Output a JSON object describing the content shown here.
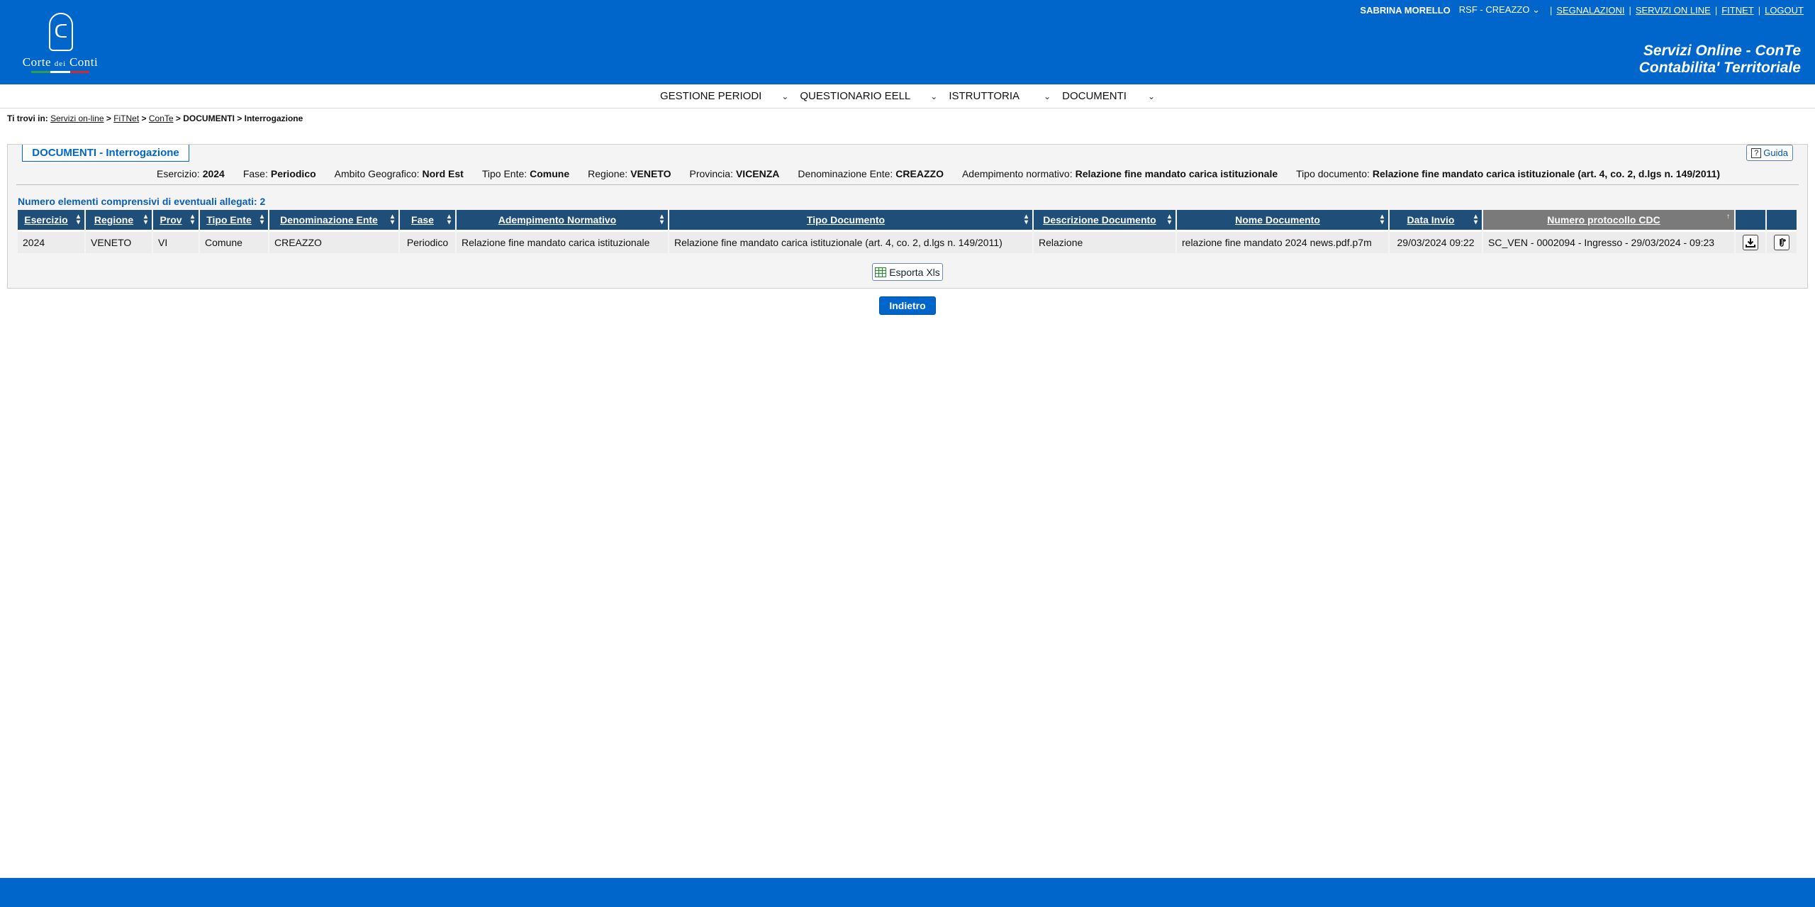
{
  "header": {
    "logo_text_main": "Corte",
    "logo_text_small": "dei",
    "logo_text_end": "Conti",
    "user_name": "SABRINA MORELLO",
    "ente": "RSF  - CREAZZO",
    "links": [
      "SEGNALAZIONI",
      "SERVIZI ON LINE",
      "FITNET",
      "LOGOUT"
    ],
    "service_line1": "Servizi Online - ConTe",
    "service_line2": "Contabilita' Territoriale"
  },
  "menu": {
    "items": [
      "GESTIONE PERIODI",
      "QUESTIONARIO EELL",
      "ISTRUTTORIA",
      "DOCUMENTI"
    ]
  },
  "breadcrumb": {
    "prefix": "Ti trovi in:",
    "links": [
      "Servizi on-line",
      "FiTNet",
      "ConTe"
    ],
    "current1": "DOCUMENTI",
    "current2": "Interrogazione"
  },
  "panel": {
    "tab_title": "DOCUMENTI - Interrogazione",
    "guide_label": "Guida",
    "filters": [
      {
        "label": "Esercizio:",
        "value": "2024"
      },
      {
        "label": "Fase:",
        "value": "Periodico"
      },
      {
        "label": "Ambito Geografico:",
        "value": "Nord Est"
      },
      {
        "label": "Tipo Ente:",
        "value": "Comune"
      },
      {
        "label": "Regione:",
        "value": "VENETO"
      },
      {
        "label": "Provincia:",
        "value": "VICENZA"
      },
      {
        "label": "Denominazione Ente:",
        "value": "CREAZZO"
      },
      {
        "label": "Adempimento normativo:",
        "value": "Relazione fine mandato carica istituzionale"
      },
      {
        "label": "Tipo documento:",
        "value": "Relazione fine mandato carica istituzionale (art. 4, co. 2, d.lgs n. 149/2011)"
      }
    ],
    "count_label": "Numero elementi comprensivi di eventuali allegati: 2"
  },
  "table": {
    "headers": [
      "Esercizio",
      "Regione",
      "Prov",
      "Tipo Ente",
      "Denominazione Ente",
      "Fase",
      "Adempimento Normativo",
      "Tipo Documento",
      "Descrizione Documento",
      "Nome Documento",
      "Data Invio",
      "Numero protocollo CDC"
    ],
    "rows": [
      [
        "2024",
        "VENETO",
        "VI",
        "Comune",
        "CREAZZO",
        "Periodico",
        "Relazione fine mandato carica istituzionale",
        "Relazione fine mandato carica istituzionale (art. 4, co. 2, d.lgs n. 149/2011)",
        "Relazione",
        "relazione fine mandato 2024 news.pdf.p7m",
        "29/03/2024 09:22",
        "SC_VEN - 0002094 - Ingresso - 29/03/2024 - 09:23"
      ]
    ]
  },
  "actions": {
    "export_label": "Esporta Xls",
    "back_label": "Indietro"
  },
  "colors": {
    "brand_blue": "#0066cc",
    "table_header": "#1f4e79",
    "sorted_header": "#7a7a7a"
  }
}
